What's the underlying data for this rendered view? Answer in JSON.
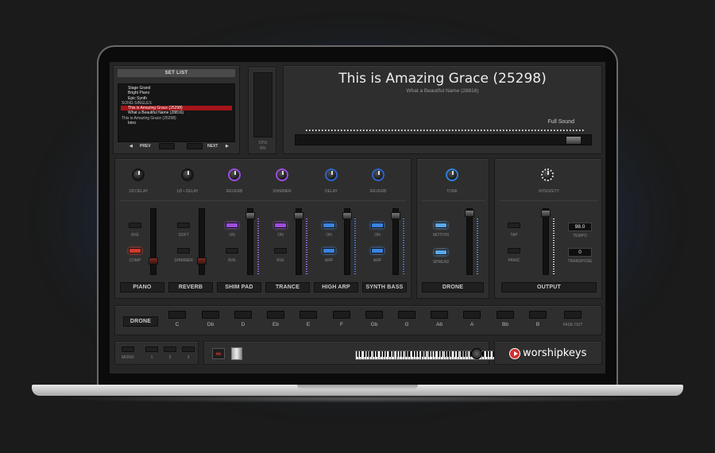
{
  "setlist": {
    "header": "SET LIST",
    "items": [
      {
        "label": "Stage Grand",
        "kind": "patch"
      },
      {
        "label": "Bright Piano",
        "kind": "patch"
      },
      {
        "label": "Epic Synth",
        "kind": "patch"
      },
      {
        "label": "SONG SINGLES",
        "kind": "category"
      },
      {
        "label": "This is Amazing Grace (25298)",
        "kind": "selected"
      },
      {
        "label": "What a Beautiful Name (28816)",
        "kind": "patch"
      },
      {
        "label": "This is Amazing Grace (25298)",
        "kind": "category"
      },
      {
        "label": "Intro",
        "kind": "patch"
      }
    ],
    "prev_label": "PREV",
    "next_label": "NEXT"
  },
  "cpu": {
    "label": "CPU",
    "value": "6%"
  },
  "song": {
    "title": "This is Amazing Grace (25298)",
    "subtitle": "What a Beautiful Name (28816)",
    "morph_label": "Full Sound",
    "morph_position": 0.97
  },
  "knobs": [
    "1/8 DELAY",
    "1/8 • DELAY",
    "REVERB",
    "SHIMMER",
    "DELAY",
    "REVERB"
  ],
  "channels": [
    {
      "name": "PIANO",
      "btn1": "8VE",
      "btn2": "COMP",
      "btn2_state": "red",
      "btn1_state": "off",
      "level": 0.85
    },
    {
      "name": "REVERB",
      "btn1": "SOFT",
      "btn2": "SHIMMER",
      "btn1_state": "off",
      "btn2_state": "off",
      "level": 0.85
    },
    {
      "name": "SHIM PAD",
      "btn1": "ON",
      "btn2": "8VE",
      "btn1_state": "purple",
      "btn2_state": "off",
      "level": 0.05
    },
    {
      "name": "TRANCE",
      "btn1": "ON",
      "btn2": "8VE",
      "btn1_state": "purple",
      "btn2_state": "off",
      "level": 0.05
    },
    {
      "name": "HIGH ARP",
      "btn1": "ON",
      "btn2": "ARP",
      "btn1_state": "blue",
      "btn2_state": "blue",
      "level": 0.05
    },
    {
      "name": "SYNTH BASS",
      "btn1": "ON",
      "btn2": "ARP",
      "btn1_state": "blue",
      "btn2_state": "blue",
      "level": 0.05
    }
  ],
  "drone": {
    "knob": "TONE",
    "btn1": "MOTION",
    "btn2": "SPREAD",
    "name": "DRONE"
  },
  "output": {
    "knob": "INTENSITY",
    "tap": "TAP",
    "panic": "PANIC",
    "tempo_value": "98.0",
    "tempo_label": "TEMPO",
    "transpose_value": "0",
    "transpose_label": "TRANSPOSE",
    "name": "OUTPUT"
  },
  "drone_keys": {
    "label": "DRONE",
    "keys": [
      "C",
      "Db",
      "D",
      "Eb",
      "E",
      "F",
      "Gb",
      "G",
      "Ab",
      "A",
      "Bb",
      "B"
    ],
    "fade": "FADE OUT"
  },
  "bottom": {
    "mono": "MONO",
    "presets": [
      "1",
      "2",
      "3"
    ],
    "brand": "worshipkeys"
  }
}
